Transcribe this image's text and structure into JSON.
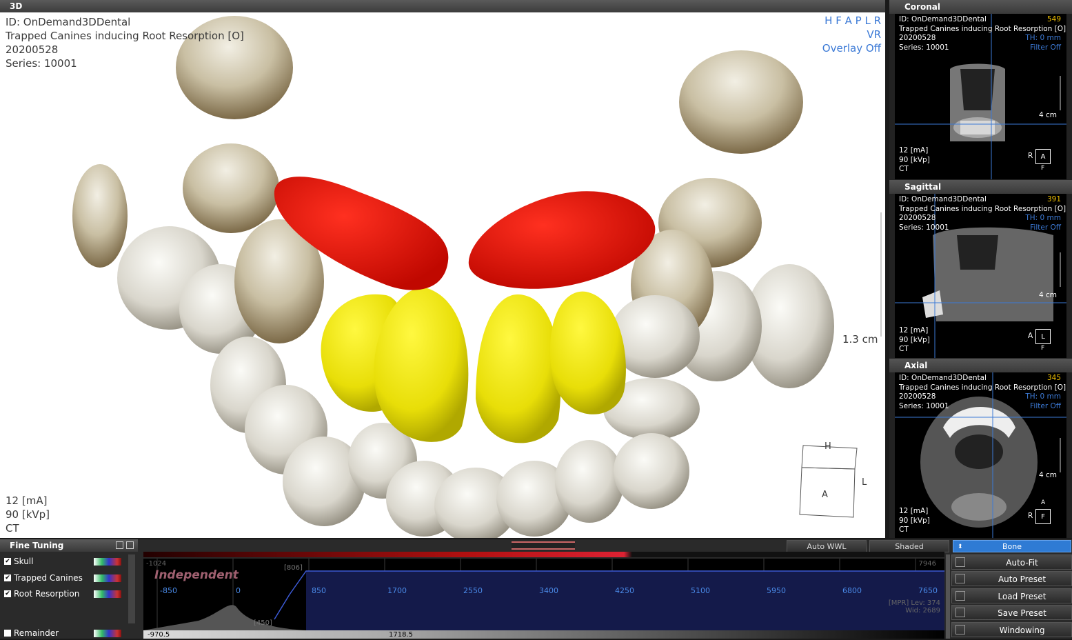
{
  "main": {
    "title": "3D",
    "overlay_tl": [
      "ID: OnDemand3DDental",
      "Trapped Canines inducing Root Resorption [O]",
      "20200528",
      "Series: 10001"
    ],
    "overlay_tr": [
      "H F A P L R",
      "VR",
      "Overlay Off"
    ],
    "overlay_bl": [
      "12 [mA]",
      "90 [kVp]",
      "CT"
    ],
    "scale_label": "1.3 cm",
    "orient_cube": {
      "top": "H",
      "front": "A",
      "right": "L"
    }
  },
  "coronal": {
    "title": "Coronal",
    "lines": [
      "ID: OnDemand3DDental",
      "Trapped Canines inducing Root Resorption [O]",
      "20200528",
      "Series: 10001"
    ],
    "slice": "549",
    "th": "TH: 0 mm",
    "filter": "Filter Off",
    "scale": "4 cm",
    "bottom": [
      "12 [mA]",
      "90 [kVp]",
      "CT"
    ],
    "orient_left": "R",
    "orient_box": "A",
    "orient_bottom": "F"
  },
  "sagittal": {
    "title": "Sagittal",
    "lines": [
      "ID: OnDemand3DDental",
      "Trapped Canines inducing Root Resorption [O]",
      "20200528",
      "Series: 10001"
    ],
    "slice": "391",
    "th": "TH: 0 mm",
    "filter": "Filter Off",
    "scale": "4 cm",
    "bottom": [
      "12 [mA]",
      "90 [kVp]",
      "CT"
    ],
    "orient_left": "A",
    "orient_box": "L",
    "orient_bottom": "F"
  },
  "axial": {
    "title": "Axial",
    "lines": [
      "ID: OnDemand3DDental",
      "Trapped Canines inducing Root Resorption [O]",
      "20200528",
      "Series: 10001"
    ],
    "slice": "345",
    "th": "TH: 0 mm",
    "filter": "Filter Off",
    "scale": "4 cm",
    "bottom": [
      "12 [mA]",
      "90 [kVp]",
      "CT"
    ],
    "orient_left": "R",
    "orient_box": "F",
    "orient_top": "A"
  },
  "fine_tuning": {
    "title": "Fine Tuning",
    "segments": [
      {
        "label": "Skull",
        "checked": true
      },
      {
        "label": "Trapped Canines",
        "checked": true
      },
      {
        "label": "Root Resorption",
        "checked": true
      },
      {
        "label": "Remainder",
        "checked": false
      }
    ],
    "auto_wwl": "Auto WWL",
    "shaded": "Shaded",
    "preset": "Bone",
    "mode": "Independent",
    "tf_min": "-1024",
    "tf_max": "7946",
    "tf_marker": "[806]",
    "tf_marker2": "[450]",
    "ticks": [
      "-850",
      "0",
      "850",
      "1700",
      "2550",
      "3400",
      "4250",
      "5100",
      "5950",
      "6800",
      "7650"
    ],
    "mpr_lev": "[MPR] Lev: 374",
    "mpr_wid": "Wid: 2689",
    "bottom_left": "-970.5",
    "bottom_mid": "1718.5"
  },
  "side_buttons": [
    "Auto-Fit",
    "Auto Preset",
    "Load Preset",
    "Save Preset",
    "Windowing"
  ],
  "colors": {
    "canine": "#f02010",
    "incisor": "#e8e010",
    "accent": "#3c7ad6",
    "preset_bg": "#2f7bd4"
  }
}
